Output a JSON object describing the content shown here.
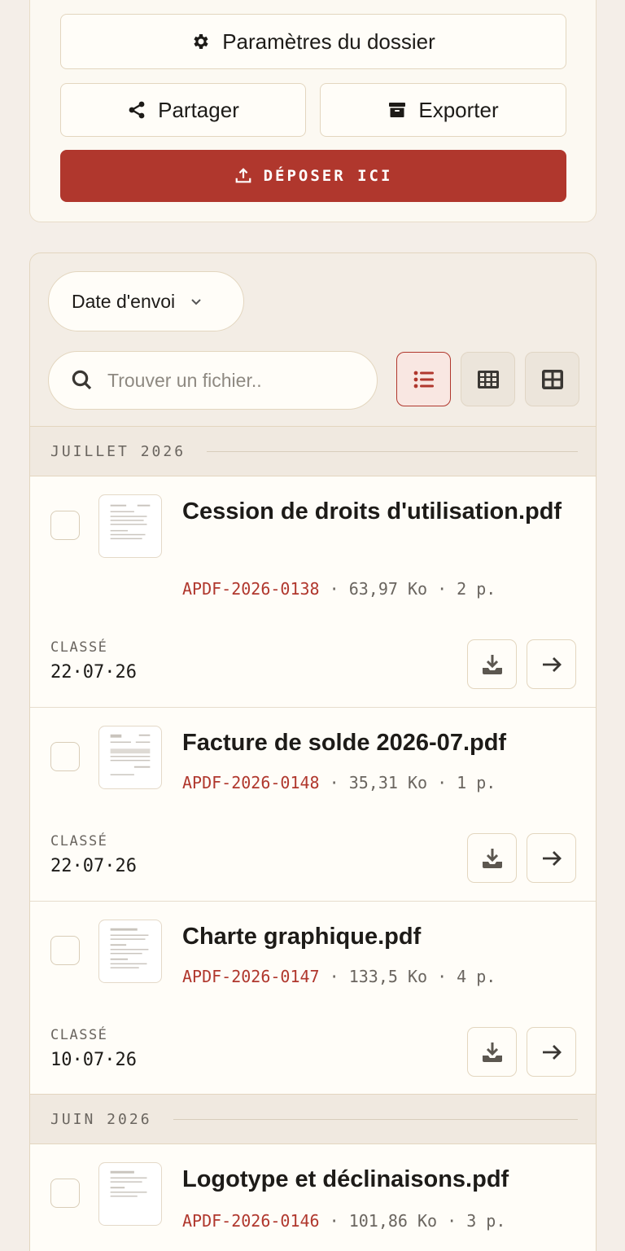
{
  "actions": {
    "settings_label": "Paramètres du dossier",
    "share_label": "Partager",
    "export_label": "Exporter",
    "upload_label": "DÉPOSER ICI"
  },
  "list": {
    "sort_label": "Date d'envoi",
    "search_placeholder": "Trouver un fichier..",
    "view_modes": [
      "list",
      "table",
      "grid"
    ],
    "active_view": "list",
    "groups": [
      {
        "title": "JUILLET 2026",
        "files": [
          {
            "name": "Cession de droits d'utilisation.pdf",
            "ref": "APDF-2026-0138",
            "size": "63,97 Ko",
            "pages": "2 p.",
            "status": "CLASSÉ",
            "date": "22·07·26"
          },
          {
            "name": "Facture de solde 2026-07.pdf",
            "ref": "APDF-2026-0148",
            "size": "35,31 Ko",
            "pages": "1 p.",
            "status": "CLASSÉ",
            "date": "22·07·26"
          },
          {
            "name": "Charte graphique.pdf",
            "ref": "APDF-2026-0147",
            "size": "133,5 Ko",
            "pages": "4 p.",
            "status": "CLASSÉ",
            "date": "10·07·26"
          }
        ]
      },
      {
        "title": "JUIN 2026",
        "files": [
          {
            "name": "Logotype et déclinaisons.pdf",
            "ref": "APDF-2026-0146",
            "size": "101,86 Ko",
            "pages": "3 p."
          }
        ]
      }
    ]
  },
  "meta_separator": " · ",
  "colors": {
    "accent": "#b0372d",
    "background": "#f4eee8",
    "card": "#fffdf8",
    "border": "#e3d6bf"
  }
}
